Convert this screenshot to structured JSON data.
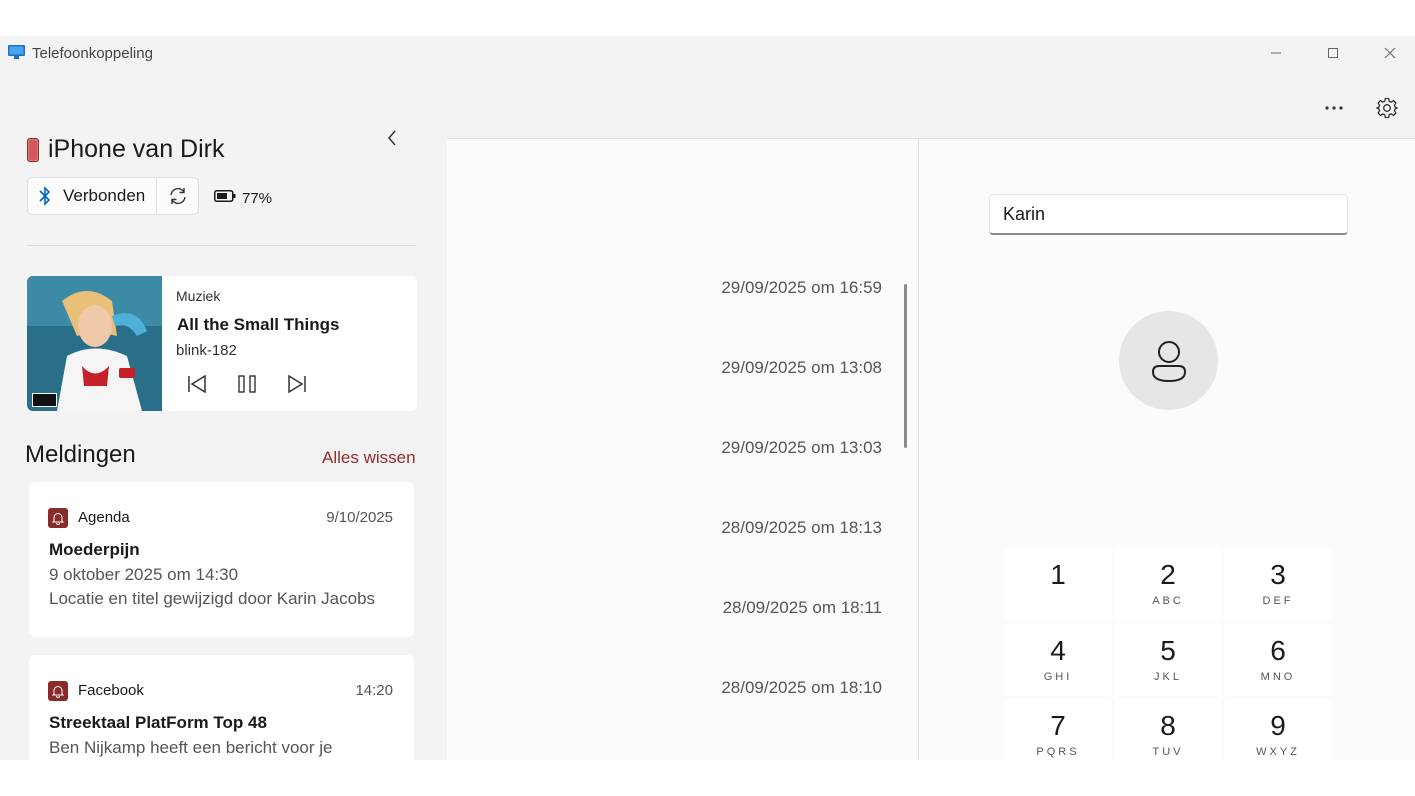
{
  "window": {
    "title": "Telefoonkoppeling"
  },
  "device": {
    "name": "iPhone van Dirk",
    "status_label": "Verbonden",
    "battery": "77%"
  },
  "media": {
    "app": "Muziek",
    "title": "All the Small Things",
    "artist": "blink-182"
  },
  "notifications": {
    "heading": "Meldingen",
    "clear_all": "Alles wissen",
    "items": [
      {
        "app": "Agenda",
        "time": "9/10/2025",
        "title": "Moederpijn",
        "body": "9 oktober 2025 om 14:30\nLocatie en titel gewijzigd door Karin Jacobs"
      },
      {
        "app": "Facebook",
        "time": "14:20",
        "title": "Streektaal PlatForm Top 48",
        "body": "Ben Nijkamp heeft een bericht voor je uitgelicht zodat je deze kunt bekijken in Streektaal PlatForm Top 48"
      }
    ]
  },
  "calls": [
    "29/09/2025 om 16:59",
    "29/09/2025 om 13:08",
    "29/09/2025 om 13:03",
    "28/09/2025 om 18:13",
    "28/09/2025 om 18:11",
    "28/09/2025 om 18:10"
  ],
  "dialer": {
    "input_value": "Karin",
    "keys": [
      {
        "digit": "1",
        "letters": ""
      },
      {
        "digit": "2",
        "letters": "ABC"
      },
      {
        "digit": "3",
        "letters": "DEF"
      },
      {
        "digit": "4",
        "letters": "GHI"
      },
      {
        "digit": "5",
        "letters": "JKL"
      },
      {
        "digit": "6",
        "letters": "MNO"
      },
      {
        "digit": "7",
        "letters": "PQRS"
      },
      {
        "digit": "8",
        "letters": "TUV"
      },
      {
        "digit": "9",
        "letters": "WXYZ"
      }
    ]
  },
  "colors": {
    "accent": "#9a2b2b",
    "bluetooth": "#0067c0",
    "background": "#f3f3f3"
  }
}
